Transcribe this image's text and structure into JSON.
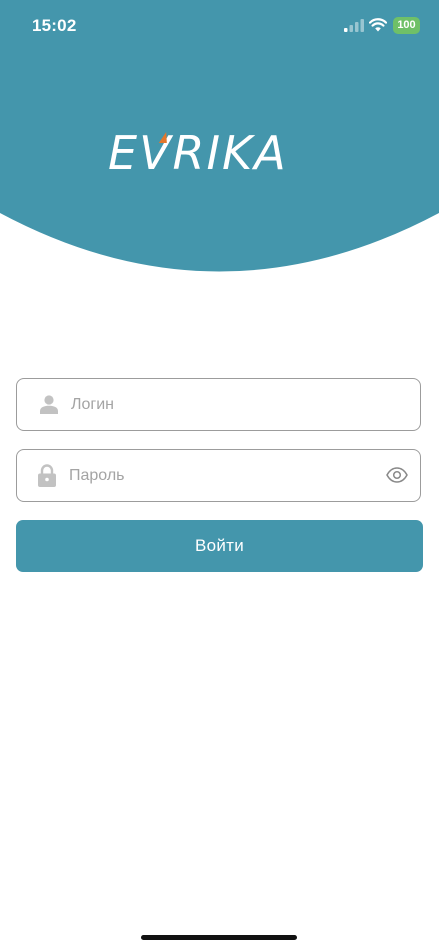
{
  "colors": {
    "brand_teal": "#4496ac",
    "logo_accent": "#e3772b",
    "battery_green": "#6fc068",
    "field_border": "#9c9c9c",
    "placeholder": "#a4a4a4",
    "icon_gray": "#c2c2c2"
  },
  "status_bar": {
    "time": "15:02",
    "battery_level": "100",
    "icons": [
      "cellular-signal-icon",
      "wifi-icon",
      "battery-icon"
    ]
  },
  "header": {
    "logo_text": "EVRIKA"
  },
  "login_form": {
    "login_field": {
      "placeholder": "Логин",
      "value": "",
      "icon": "user-icon"
    },
    "password_field": {
      "placeholder": "Пароль",
      "value": "",
      "icon": "lock-icon",
      "toggle_icon": "eye-icon"
    },
    "submit_label": "Войти"
  }
}
